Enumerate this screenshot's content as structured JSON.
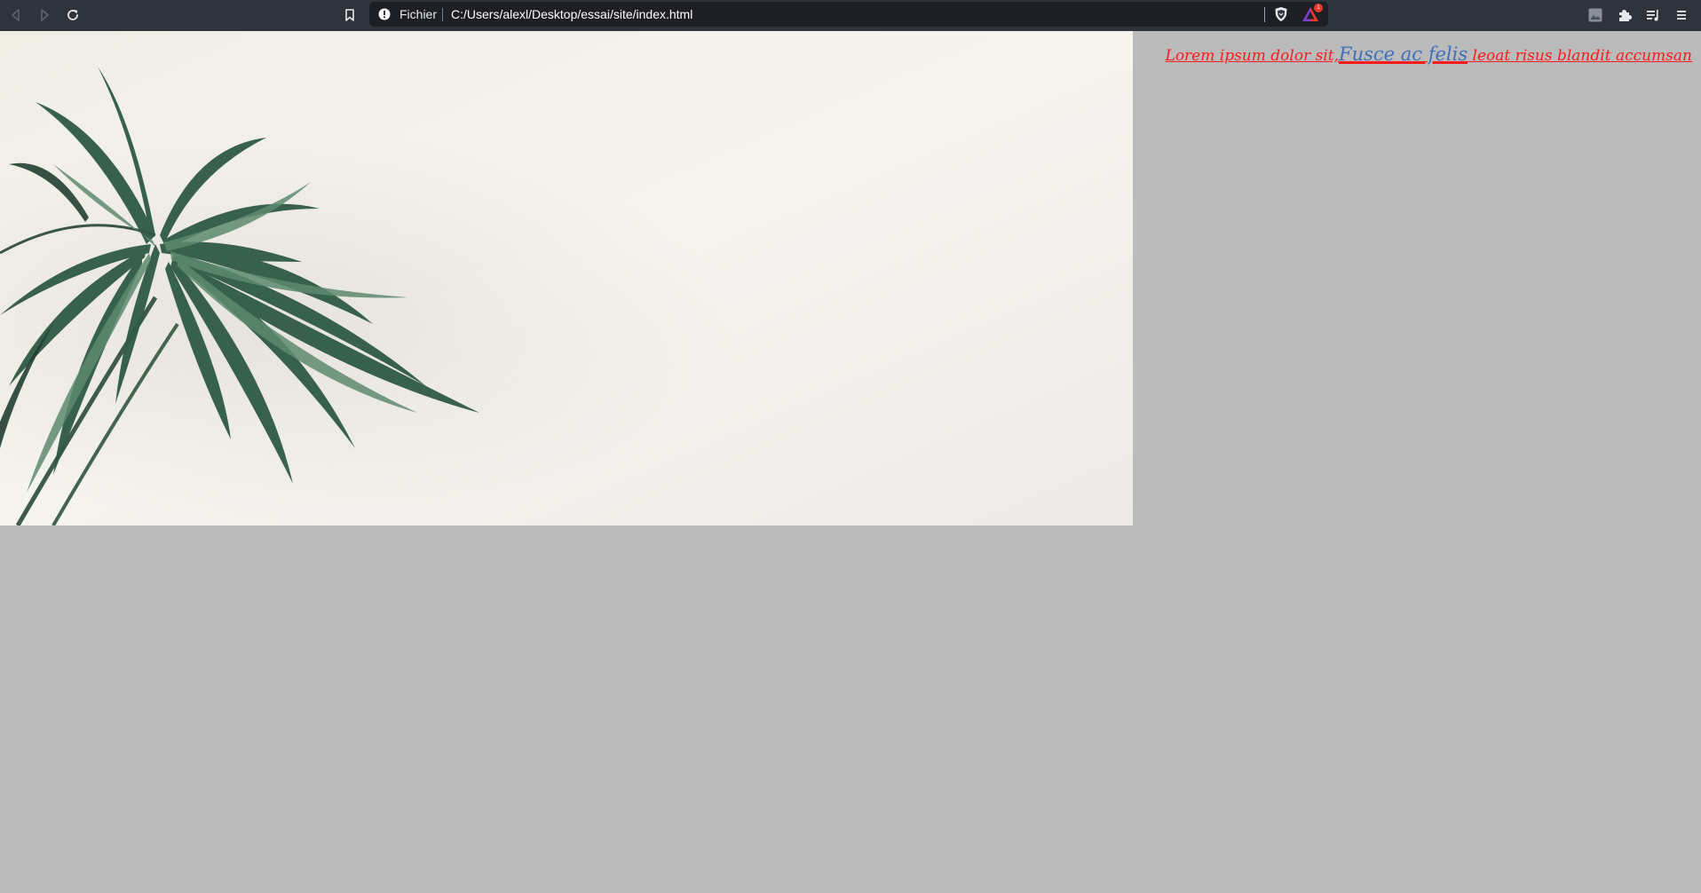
{
  "browser": {
    "url_scheme_label": "Fichier",
    "url": "C:/Users/alexl/Desktop/essai/site/index.html",
    "rewards_badge_count": "1",
    "toolbar_bg": "#2f333c",
    "urlbar_bg": "#1d1f25"
  },
  "page": {
    "background": "#bbbbbb",
    "hero_image_icon": "palm-leaves-on-white-wall",
    "headline": {
      "text_before": "Lorem ipsum dolor sit,",
      "link_text": "Fusce ac felis",
      "text_after": " leoat risus blandit accumsan",
      "text_color": "#ff1a1a",
      "link_color": "#3f6fb8"
    }
  }
}
